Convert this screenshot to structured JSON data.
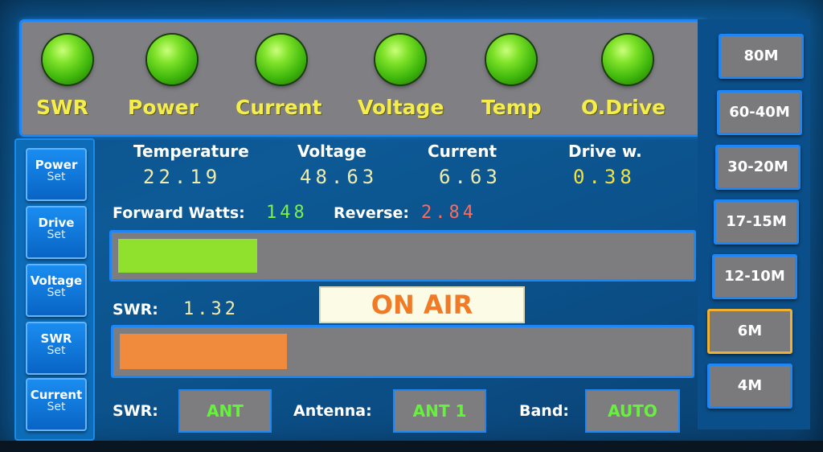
{
  "indicators": [
    {
      "label": "SWR",
      "color": "#5fd21a"
    },
    {
      "label": "Power",
      "color": "#5fd21a"
    },
    {
      "label": "Current",
      "color": "#5fd21a"
    },
    {
      "label": "Voltage",
      "color": "#5fd21a"
    },
    {
      "label": "Temp",
      "color": "#5fd21a"
    },
    {
      "label": "O.Drive",
      "color": "#5fd21a"
    }
  ],
  "set_buttons": [
    {
      "title": "Power",
      "sub": "Set"
    },
    {
      "title": "Drive",
      "sub": "Set"
    },
    {
      "title": "Voltage",
      "sub": "Set"
    },
    {
      "title": "SWR",
      "sub": "Set"
    },
    {
      "title": "Current",
      "sub": "Set"
    }
  ],
  "readouts": {
    "temperature": {
      "label": "Temperature",
      "value": "22.19"
    },
    "voltage": {
      "label": "Voltage",
      "value": "48.63"
    },
    "current": {
      "label": "Current",
      "value": "6.63"
    },
    "drive": {
      "label": "Drive w.",
      "value": "0.38"
    }
  },
  "power": {
    "forward_label": "Forward Watts:",
    "forward_value": "148",
    "reverse_label": "Reverse:",
    "reverse_value": "2.84",
    "forward_bar_fraction": 0.245,
    "forward_bar_color": "#8fe12e"
  },
  "swr": {
    "label": "SWR:",
    "value": "1.32",
    "bar_fraction": 0.295,
    "bar_color": "#f08a3c"
  },
  "on_air": "ON AIR",
  "selectors": {
    "swr_label": "SWR:",
    "swr_value": "ANT",
    "antenna_label": "Antenna:",
    "antenna_value": "ANT 1",
    "band_label": "Band:",
    "band_value": "AUTO"
  },
  "bands": [
    {
      "label": "80M",
      "active": false
    },
    {
      "label": "60-40M",
      "active": false
    },
    {
      "label": "30-20M",
      "active": false
    },
    {
      "label": "17-15M",
      "active": false
    },
    {
      "label": "12-10M",
      "active": false
    },
    {
      "label": "6M",
      "active": true
    },
    {
      "label": "4M",
      "active": false
    }
  ],
  "colors": {
    "accent_blue": "#1f86f5",
    "readout_value": "#f3eca8",
    "forward_value": "#7ef04a",
    "reverse_value": "#ff6b5a",
    "active_band_border": "#f0b132"
  }
}
